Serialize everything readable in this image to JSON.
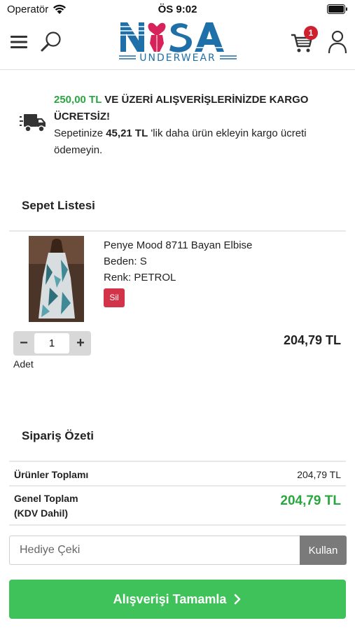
{
  "status_bar": {
    "carrier": "Operatör",
    "time": "ÖS 9:02"
  },
  "header": {
    "logo_text": "NISA",
    "logo_subtitle": "UNDERWEAR",
    "cart_count": "1",
    "brand_color": "#1f6fa8",
    "accent_color": "#d6245a"
  },
  "shipping_notice": {
    "threshold": "250,00 TL",
    "headline": " VE ÜZERİ ALIŞVERİŞLERİNİZDE KARGO ÜCRETSİZ!",
    "line_prefix": "Sepetinize ",
    "remaining": "45,21 TL",
    "line_suffix": " 'lik daha ürün ekleyin kargo ücreti ödemeyin."
  },
  "cart": {
    "title": "Sepet Listesi",
    "items": [
      {
        "name": "Penye Mood 8711 Bayan Elbise",
        "size": "Beden: S",
        "color": "Renk: PETROL",
        "delete_label": "Sil",
        "quantity": "1",
        "quantity_label": "Adet",
        "price": "204,79 TL",
        "decrement": "−",
        "increment": "+"
      }
    ]
  },
  "summary": {
    "title": "Sipariş Özeti",
    "subtotal_label": "Ürünler Toplamı",
    "subtotal_value": "204,79 TL",
    "total_label_1": "Genel Toplam",
    "total_label_2": "(KDV Dahil)",
    "total_value": "204,79 TL"
  },
  "gift": {
    "placeholder": "Hediye Çeki",
    "button_label": "Kullan"
  },
  "checkout": {
    "button_label": "Alışverişi Tamamla",
    "button_color": "#3fc25a"
  }
}
